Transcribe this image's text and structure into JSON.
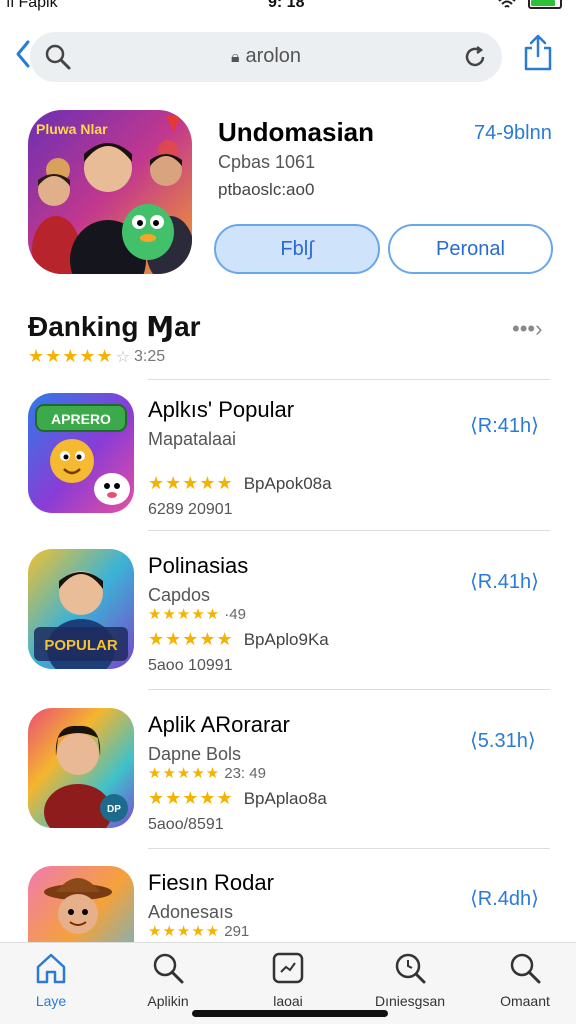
{
  "status_bar": {
    "carrier": "ıl Fapik",
    "time": "9: 18"
  },
  "search": {
    "url_text": "arolon"
  },
  "app": {
    "title": "Undomasian",
    "size": "74-9blnn",
    "subtitle": "Cpbas 1061",
    "developer": "ptbaoslc:ao0",
    "primary_button": "Fbl∫",
    "secondary_button": "Peronal",
    "icon_caption": "Pluwa Nlar"
  },
  "section": {
    "title": "Ɖanking Ɱar",
    "more": "•••›",
    "stars": "★★★★★",
    "empty_star": "☆",
    "score": "3:25"
  },
  "items": [
    {
      "title": "Aplkıs' Popular",
      "subtitle": "Mapatalaai",
      "mini_rating": "",
      "stars": "★★★★★",
      "rating_text": "BpApok08a",
      "count": "6289 20901",
      "size": "⟨R:41h⟩",
      "icon_caption": "APRERO"
    },
    {
      "title": "Polinasias",
      "subtitle": "Capdos",
      "mini_rating": "·49",
      "stars": "★★★★★",
      "rating_text": "BpAplo9Ka",
      "count": "5aoo 10991",
      "size": "⟨R.41h⟩",
      "icon_caption": "POPULAR"
    },
    {
      "title": "Aplik ARorarar",
      "subtitle": "Dapne Bols",
      "mini_rating": "23: 49",
      "stars": "★★★★★",
      "rating_text": "BpAplao8a",
      "count": "5aoo/8591",
      "size": "⟨5.31h⟩",
      "icon_caption": "DP"
    },
    {
      "title": "Fiesın Rodar",
      "subtitle": "Adonesaıs",
      "mini_rating": "291",
      "stars": "★★★★★",
      "rating_text": "",
      "count": "",
      "size": "⟨R.4dh⟩",
      "icon_caption": ""
    }
  ],
  "tabs": [
    {
      "label": "Laye",
      "icon": "home-icon"
    },
    {
      "label": "Aplikin",
      "icon": "search-icon"
    },
    {
      "label": "Ɩaoai",
      "icon": "chart-icon"
    },
    {
      "label": "Dıniesgsan",
      "icon": "magnifier-icon"
    },
    {
      "label": "Omaant",
      "icon": "search-icon"
    }
  ],
  "colors": {
    "accent": "#2a7ad8",
    "star": "#f5b301",
    "button_fill": "#cfe3fb"
  }
}
